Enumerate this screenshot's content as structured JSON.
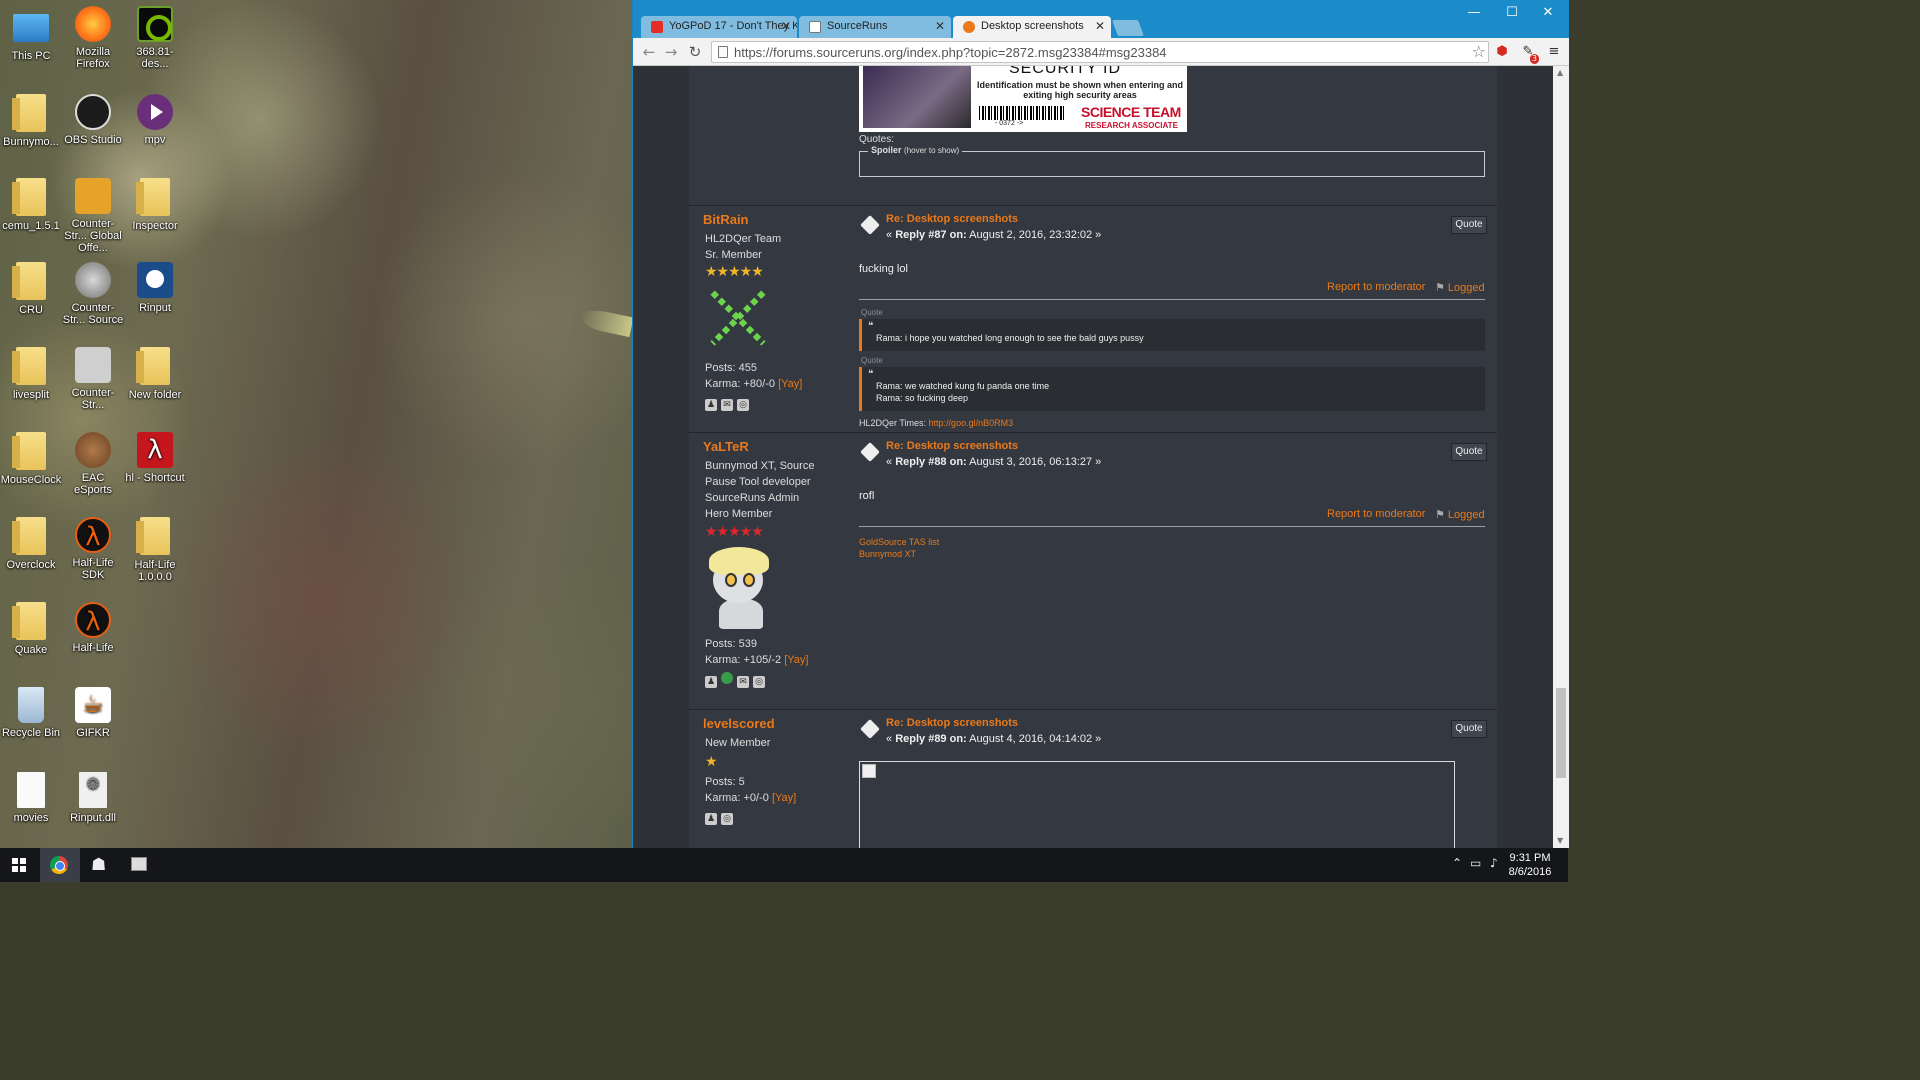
{
  "desktop": {
    "icons": [
      {
        "label": "This PC",
        "icon": "this-pc-icon"
      },
      {
        "label": "Mozilla Firefox",
        "icon": "firefox-icon"
      },
      {
        "label": "368.81-des...",
        "icon": "nvidia-icon"
      },
      {
        "label": "Bunnymo...",
        "icon": "folder-icon"
      },
      {
        "label": "OBS Studio",
        "icon": "obs-icon"
      },
      {
        "label": "mpv",
        "icon": "mpv-icon"
      },
      {
        "label": "cemu_1.5.1",
        "icon": "folder-icon"
      },
      {
        "label": "Counter-Str... Global Offe...",
        "icon": "csgo-icon"
      },
      {
        "label": "Inspector",
        "icon": "folder-icon"
      },
      {
        "label": "CRU",
        "icon": "folder-icon"
      },
      {
        "label": "Counter-Str... Source",
        "icon": "css-icon"
      },
      {
        "label": "Rinput",
        "icon": "rinput-icon"
      },
      {
        "label": "livesplit",
        "icon": "folder-icon"
      },
      {
        "label": "Counter-Str...",
        "icon": "cs-icon"
      },
      {
        "label": "New folder",
        "icon": "folder-icon"
      },
      {
        "label": "MouseClock",
        "icon": "folder-icon"
      },
      {
        "label": "EAC eSports",
        "icon": "eac-icon"
      },
      {
        "label": "hl - Shortcut",
        "icon": "half-life-icon"
      },
      {
        "label": "Overclock",
        "icon": "folder-icon"
      },
      {
        "label": "Half-Life SDK",
        "icon": "half-life-sdk-icon"
      },
      {
        "label": "Half-Life 1.0.0.0",
        "icon": "folder-icon"
      },
      {
        "label": "Quake",
        "icon": "folder-icon"
      },
      {
        "label": "Half-Life",
        "icon": "half-life-icon"
      },
      {
        "label": "Recycle Bin",
        "icon": "recycle-bin-icon"
      },
      {
        "label": "GIFKR",
        "icon": "java-icon"
      },
      {
        "label": "movies",
        "icon": "document-icon"
      },
      {
        "label": "Rinput.dll",
        "icon": "dll-icon"
      }
    ]
  },
  "browser": {
    "tabs": [
      {
        "title": "YoGPoD 17 - Don't They K",
        "favicon": "youtube-icon",
        "active": false
      },
      {
        "title": "SourceRuns",
        "favicon": "page-icon",
        "active": false
      },
      {
        "title": "Desktop screenshots",
        "favicon": "sourceruns-icon",
        "active": true
      }
    ],
    "window_buttons": {
      "minimize": "—",
      "maximize": "☐",
      "close": "✕"
    },
    "url": "https://forums.sourceruns.org/index.php?topic=2872.msg23384#msg23384",
    "extension_badge": "3"
  },
  "page": {
    "top_signature": {
      "title": "SECURITY ID",
      "notice": "Identification must be shown when entering and exiting high security areas",
      "barcode_number": "- 0372 ->",
      "team": "SCIENCE TEAM",
      "role": "RESEARCH ASSOCIATE",
      "quotes_label": "Quotes:",
      "spoiler_label": "Spoiler",
      "spoiler_hint": "(hover to show)"
    },
    "quote_label": "Quote",
    "report_label": "Report to moderator",
    "logged_label": "Logged",
    "posts": [
      {
        "author": "BitRain",
        "ranks": [
          "HL2DQer Team",
          "Sr. Member"
        ],
        "stars": "★★★★★",
        "posts": "Posts: 455",
        "karma": "Karma: +80/-0",
        "yay": "[Yay]",
        "subject": "Re: Desktop screenshots",
        "reply_prefix": "«",
        "reply_number": "Reply #87 on:",
        "reply_date": "August 2, 2016, 23:32:02 »",
        "body": "fucking lol",
        "sig_quotes": [
          {
            "header": "Quote",
            "lines": [
              "Rama: i hope you watched long enough to see the bald guys pussy"
            ]
          },
          {
            "header": "Quote",
            "lines": [
              "Rama: we watched kung fu panda one time",
              "Rama: so fucking deep"
            ]
          }
        ],
        "sig_text": "HL2DQer Times:",
        "sig_link": "http://goo.gl/nB0RM3"
      },
      {
        "author": "YaLTeR",
        "ranks": [
          "Bunnymod XT, Source",
          "Pause Tool developer",
          "SourceRuns Admin",
          "Hero Member"
        ],
        "stars": "★★★★★",
        "posts": "Posts: 539",
        "karma": "Karma: +105/-2",
        "yay": "[Yay]",
        "subject": "Re: Desktop screenshots",
        "reply_prefix": "«",
        "reply_number": "Reply #88 on:",
        "reply_date": "August 3, 2016, 06:13:27 »",
        "body": "rofl",
        "sig_links": [
          "GoldSource TAS list",
          "Bunnymod XT"
        ]
      },
      {
        "author": "levelscored",
        "ranks": [
          "New Member"
        ],
        "stars": "★",
        "posts": "Posts: 5",
        "karma": "Karma: +0/-0",
        "yay": "[Yay]",
        "subject": "Re: Desktop screenshots",
        "reply_prefix": "«",
        "reply_number": "Reply #89 on:",
        "reply_date": "August 4, 2016, 04:14:02 »"
      }
    ]
  },
  "taskbar": {
    "clock_time": "9:31 PM",
    "clock_date": "8/6/2016"
  },
  "colors": {
    "accent_orange": "#e9791a",
    "titlebar_blue": "#1b8cc9",
    "star_gold": "#f0b428",
    "star_red": "#e0262b"
  }
}
